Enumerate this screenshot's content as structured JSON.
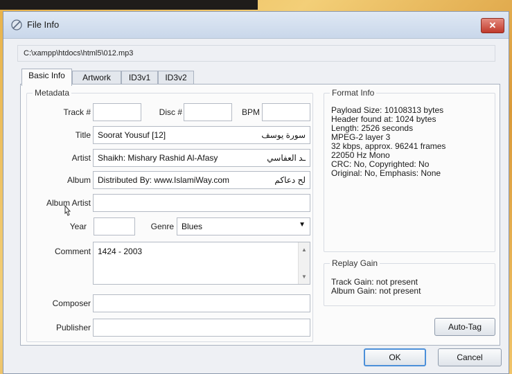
{
  "window": {
    "title": "File Info",
    "close_symbol": "✕"
  },
  "path": "C:\\xampp\\htdocs\\html5\\012.mp3",
  "tabs": [
    {
      "label": "Basic Info",
      "active": true
    },
    {
      "label": "Artwork",
      "active": false
    },
    {
      "label": "ID3v1",
      "active": false
    },
    {
      "label": "ID3v2",
      "active": false
    }
  ],
  "metadata": {
    "group_label": "Metadata",
    "track_label": "Track #",
    "track_value": "",
    "disc_label": "Disc #",
    "disc_value": "",
    "bpm_label": "BPM",
    "bpm_value": "",
    "title_label": "Title",
    "title_value": "Soorat Yousuf [12]",
    "title_rtl": "سورة يوسف",
    "artist_label": "Artist",
    "artist_value": "Shaikh: Mishary Rashid Al-Afasy",
    "artist_rtl": "ـد العفاسي",
    "album_label": "Album",
    "album_value": "Distributed By: www.IslamiWay.com",
    "album_rtl": "لح دعاكم",
    "album_artist_label": "Album Artist",
    "album_artist_value": "",
    "year_label": "Year",
    "year_value": "",
    "genre_label": "Genre",
    "genre_value": "Blues",
    "comment_label": "Comment",
    "comment_value": "1424 - 2003",
    "composer_label": "Composer",
    "composer_value": "",
    "publisher_label": "Publisher",
    "publisher_value": ""
  },
  "format_info": {
    "group_label": "Format Info",
    "lines": [
      "Payload Size: 10108313 bytes",
      "Header found at: 1024 bytes",
      "Length: 2526 seconds",
      "MPEG-2 layer 3",
      "32 kbps, approx. 96241 frames",
      "22050 Hz Mono",
      "CRC: No, Copyrighted: No",
      "Original: No, Emphasis: None"
    ]
  },
  "replay_gain": {
    "group_label": "Replay Gain",
    "track_gain": "Track Gain: not present",
    "album_gain": "Album Gain: not present"
  },
  "buttons": {
    "auto_tag": "Auto-Tag",
    "ok": "OK",
    "cancel": "Cancel"
  },
  "icons": {
    "title": "file-info-icon",
    "close": "close-icon",
    "dropdown": "chevron-down-icon",
    "cursor": "mouse-cursor-icon"
  }
}
